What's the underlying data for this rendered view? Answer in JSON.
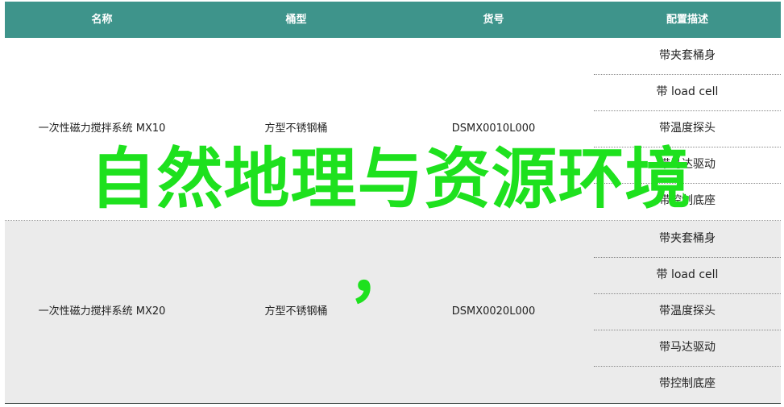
{
  "table": {
    "headers": [
      "名称",
      "桶型",
      "货号",
      "配置描述"
    ],
    "rows": [
      {
        "name": "一次性磁力搅拌系统 MX10",
        "type": "方型不锈钢桶",
        "code": "DSMX0010L000",
        "configs": [
          "带夹套桶身",
          "带 load cell",
          "带温度探头",
          "带马达驱动",
          "带控制底座"
        ]
      },
      {
        "name": "一次性磁力搅拌系统 MX20",
        "type": "方型不锈钢桶",
        "code": "DSMX0020L000",
        "configs": [
          "带夹套桶身",
          "带 load cell",
          "带温度探头",
          "带马达驱动",
          "带控制底座"
        ]
      }
    ]
  },
  "overlay": {
    "title": "自然地理与资源环境",
    "mark": "，"
  },
  "colors": {
    "header_bg": "#3e948b",
    "header_text": "#ffffff",
    "alt_row_bg": "#ebebeb",
    "overlay_text": "#1ee11e"
  }
}
